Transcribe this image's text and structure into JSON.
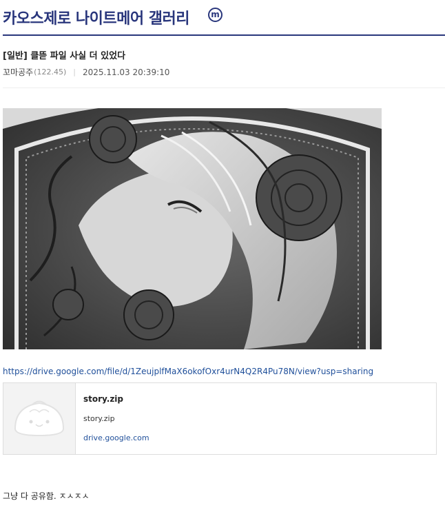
{
  "gallery": {
    "title": "카오스제로 나이트메어 갤러리",
    "badge": "m"
  },
  "post": {
    "title": "[일반] 클뜯 파일 사실 더 있었다",
    "author": "꼬마공주",
    "author_level": "(122.45)",
    "separator": "|",
    "date": "2025.11.03 20:39:10",
    "link": "https://drive.google.com/file/d/1ZeujplfMaX6okofOxr4urN4Q2R4Pu78N/view?usp=sharing",
    "body_text": "그냥 다 공유함. ㅈㅅㅈㅅ"
  },
  "og_card": {
    "title": "story.zip",
    "description": "story.zip",
    "domain": "drive.google.com",
    "thumbnail_icon": "dumpling-placeholder-icon"
  },
  "image": {
    "description_icon": "grayscale-illustration"
  }
}
